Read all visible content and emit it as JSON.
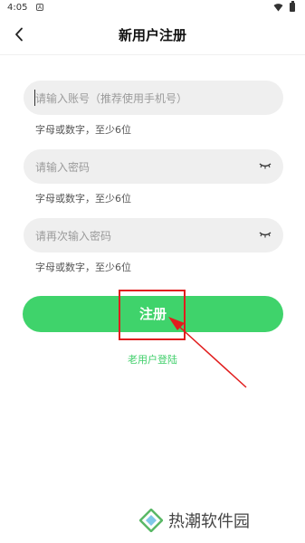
{
  "status_bar": {
    "time": "4:05",
    "notification_icon": "A"
  },
  "header": {
    "title": "新用户注册",
    "back_icon": "chevron-left-icon"
  },
  "form": {
    "account": {
      "placeholder": "请输入账号（推荐使用手机号）",
      "hint": "字母或数字，至少6位"
    },
    "password": {
      "placeholder": "请输入密码",
      "hint": "字母或数字，至少6位",
      "icon": "eye-closed-icon"
    },
    "confirm_password": {
      "placeholder": "请再次输入密码",
      "hint": "字母或数字，至少6位",
      "icon": "eye-closed-icon"
    }
  },
  "register_button": {
    "label": "注册",
    "color": "#3fd36b"
  },
  "old_user_link": {
    "label": "老用户登陆",
    "color": "#3fcf6a"
  },
  "annotation": {
    "color": "#e11d1d"
  },
  "watermark": {
    "text": "热潮软件园"
  }
}
